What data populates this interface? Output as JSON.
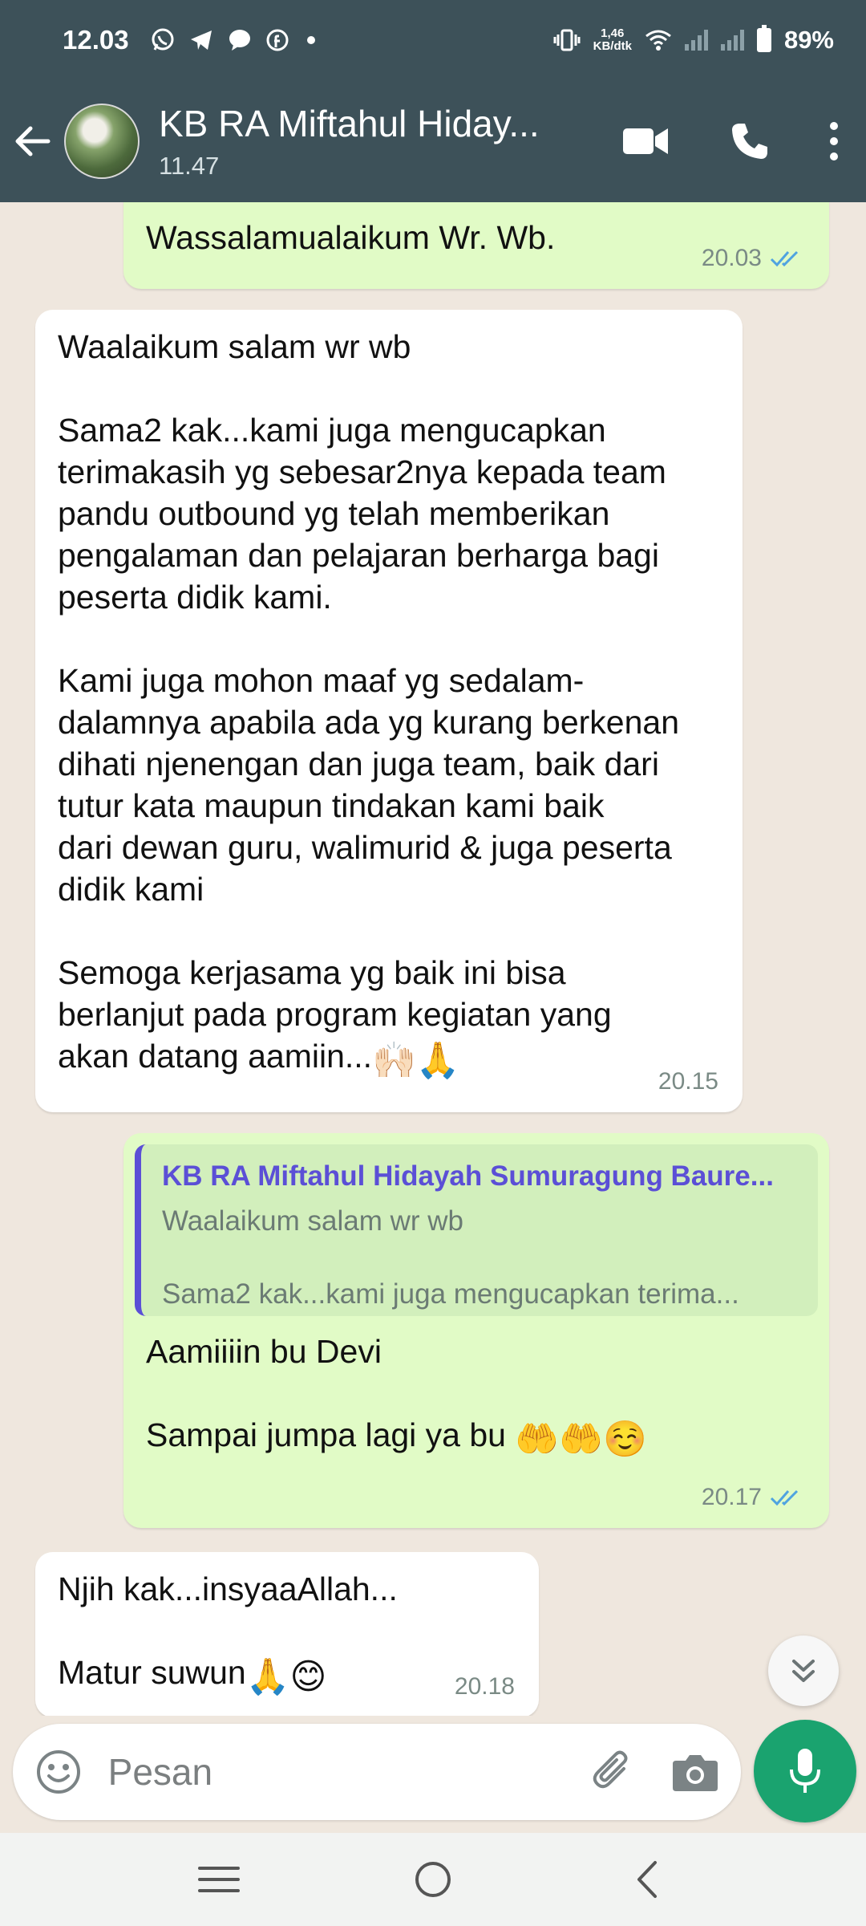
{
  "status_bar": {
    "time": "12.03",
    "speed_value": "1,46",
    "speed_unit": "KB/dtk",
    "battery": "89%"
  },
  "app_bar": {
    "title": "KB RA Miftahul Hiday...",
    "subtitle": "11.47"
  },
  "messages": [
    {
      "direction": "out",
      "text": "Wassalamualaikum Wr. Wb.",
      "time": "20.03",
      "status": "read"
    },
    {
      "direction": "in",
      "text": "Waalaikum salam wr wb\n\nSama2 kak...kami juga mengucapkan\nterimakasih yg sebesar2nya kepada team\npandu outbound yg telah memberikan\npengalaman dan pelajaran berharga bagi\npeserta didik kami.\n\nKami juga mohon maaf yg sedalam-\ndalamnya apabila ada yg kurang berkenan\ndihati njenengan dan juga team, baik dari\ntutur kata maupun tindakan kami baik\ndari dewan guru, walimurid & juga peserta\ndidik kami\n\nSemoga kerjasama yg baik ini bisa\nberlanjut pada program kegiatan yang\nakan datang aamiin...",
      "emoji": "🙌🏻🙏",
      "time": "20.15"
    },
    {
      "direction": "out",
      "quote": {
        "author": "KB RA Miftahul Hidayah Sumuragung Baure...",
        "line1": "Waalaikum salam wr wb",
        "line2": "Sama2 kak...kami juga mengucapkan terima..."
      },
      "text": "Aamiiiin bu Devi\n\nSampai jumpa lagi ya bu ",
      "emoji": "🤲🤲☺️",
      "time": "20.17",
      "status": "read"
    },
    {
      "direction": "in",
      "text": "Njih kak...insyaaAllah...\n\nMatur suwun",
      "emoji": "🙏😊",
      "time": "20.18"
    }
  ],
  "input": {
    "placeholder": "Pesan"
  },
  "icons": {
    "back": "arrow-left-icon",
    "video": "video-call-icon",
    "call": "phone-icon",
    "menu": "more-vert-icon",
    "emoji": "emoji-icon",
    "attach": "paperclip-icon",
    "camera": "camera-icon",
    "mic": "microphone-icon",
    "scroll": "chevron-double-down-icon"
  },
  "colors": {
    "header": "#3d5159",
    "outgoing_bubble": "#e1fbc6",
    "incoming_bubble": "#ffffff",
    "chat_background": "#efe7de",
    "accent_green": "#1aa36f",
    "read_ticks": "#4fa3e0",
    "quote_accent": "#5b4fd6"
  }
}
